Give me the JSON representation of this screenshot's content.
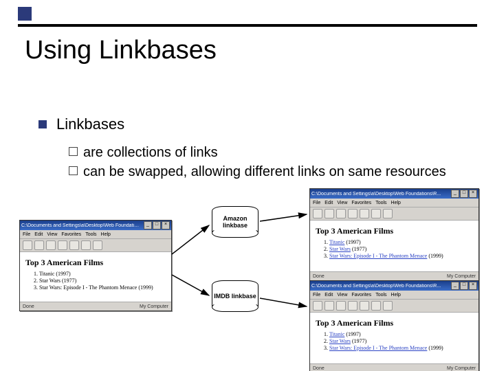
{
  "title": "Using Linkbases",
  "bullet1": "Linkbases",
  "sub1": "are collections of links",
  "sub2": "can be swapped, allowing different links on same resources",
  "cylinders": {
    "amazon": "Amazon linkbase",
    "imdb": "IMDB linkbase"
  },
  "browser": {
    "titlebar": "C:\\Documents and Settings\\a\\Desktop\\Web Foundations\\R...",
    "titlebar_r": "C:\\Documents and Settings\\a\\Desktop\\Web Foundations\\R...",
    "menus": [
      "File",
      "Edit",
      "View",
      "Favorites",
      "Tools",
      "Help"
    ],
    "heading": "Top 3 American Films",
    "items_plain": [
      "Titanic (1997)",
      "Star Wars (1977)",
      "Star Wars: Episode I - The Phantom Menace (1999)"
    ],
    "items_linked": [
      {
        "t": "Titanic",
        "y": "(1997)"
      },
      {
        "t": "Star Wars",
        "y": "(1977)"
      },
      {
        "t": "Star Wars: Episode I - The Phantom Menace",
        "y": "(1999)"
      }
    ],
    "status_done": "Done",
    "status_loc": "My Computer"
  }
}
